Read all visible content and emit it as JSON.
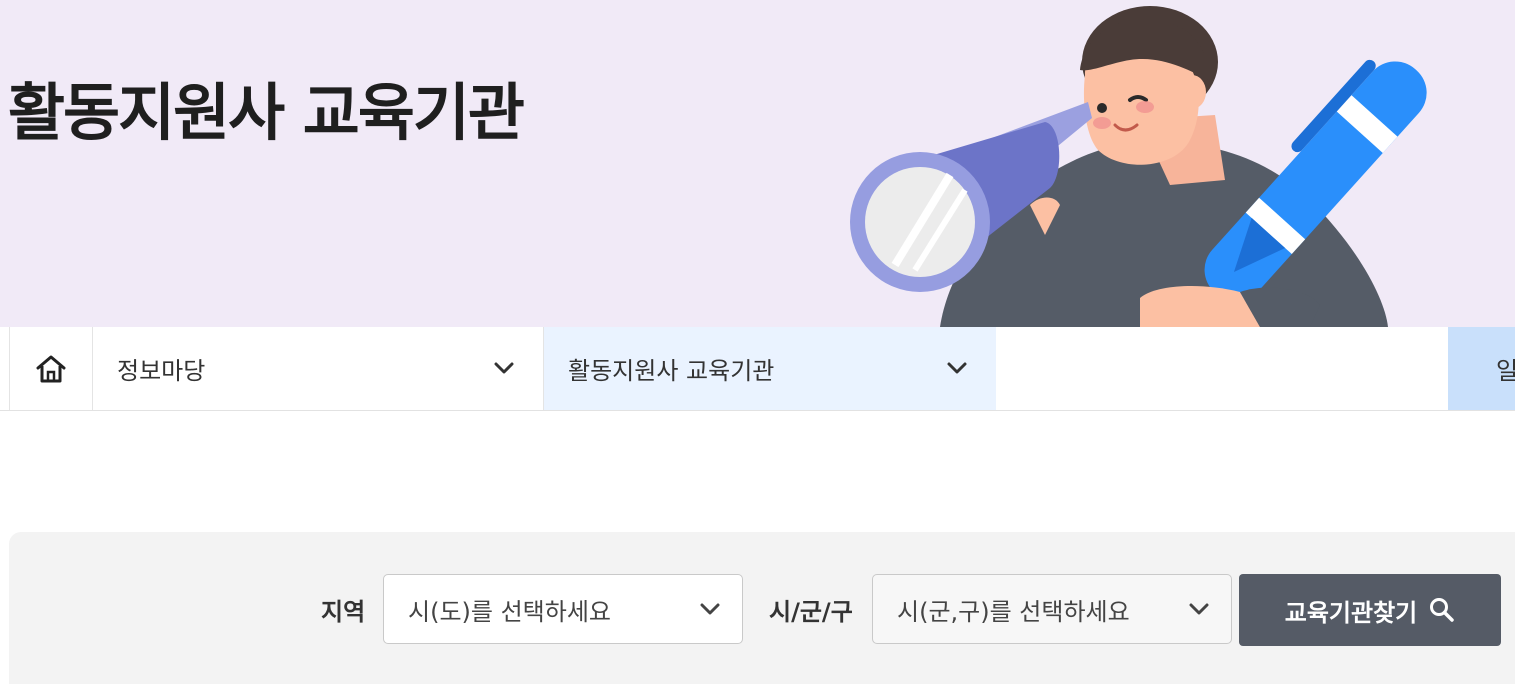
{
  "hero": {
    "title": "활동지원사 교육기관"
  },
  "breadcrumb": {
    "home_icon": "home-icon",
    "items": [
      {
        "label": "정보마당",
        "icon": "chevron-down-icon"
      },
      {
        "label": "활동지원사 교육기관",
        "icon": "chevron-down-icon"
      },
      {
        "label": "일"
      }
    ]
  },
  "search": {
    "region_label": "지역",
    "region_placeholder": "시(도)를 선택하세요",
    "district_label": "시/군/구",
    "district_placeholder": "시(군,구)를 선택하세요",
    "button_label": "교육기관찾기",
    "button_icon": "search-icon"
  },
  "colors": {
    "hero_bg": "#f1eaf7",
    "crumb_active_bg": "#eaf3ff",
    "crumb_next_bg": "#c9e0fb",
    "button_bg": "#555b66",
    "panel_bg": "#f3f3f3"
  }
}
